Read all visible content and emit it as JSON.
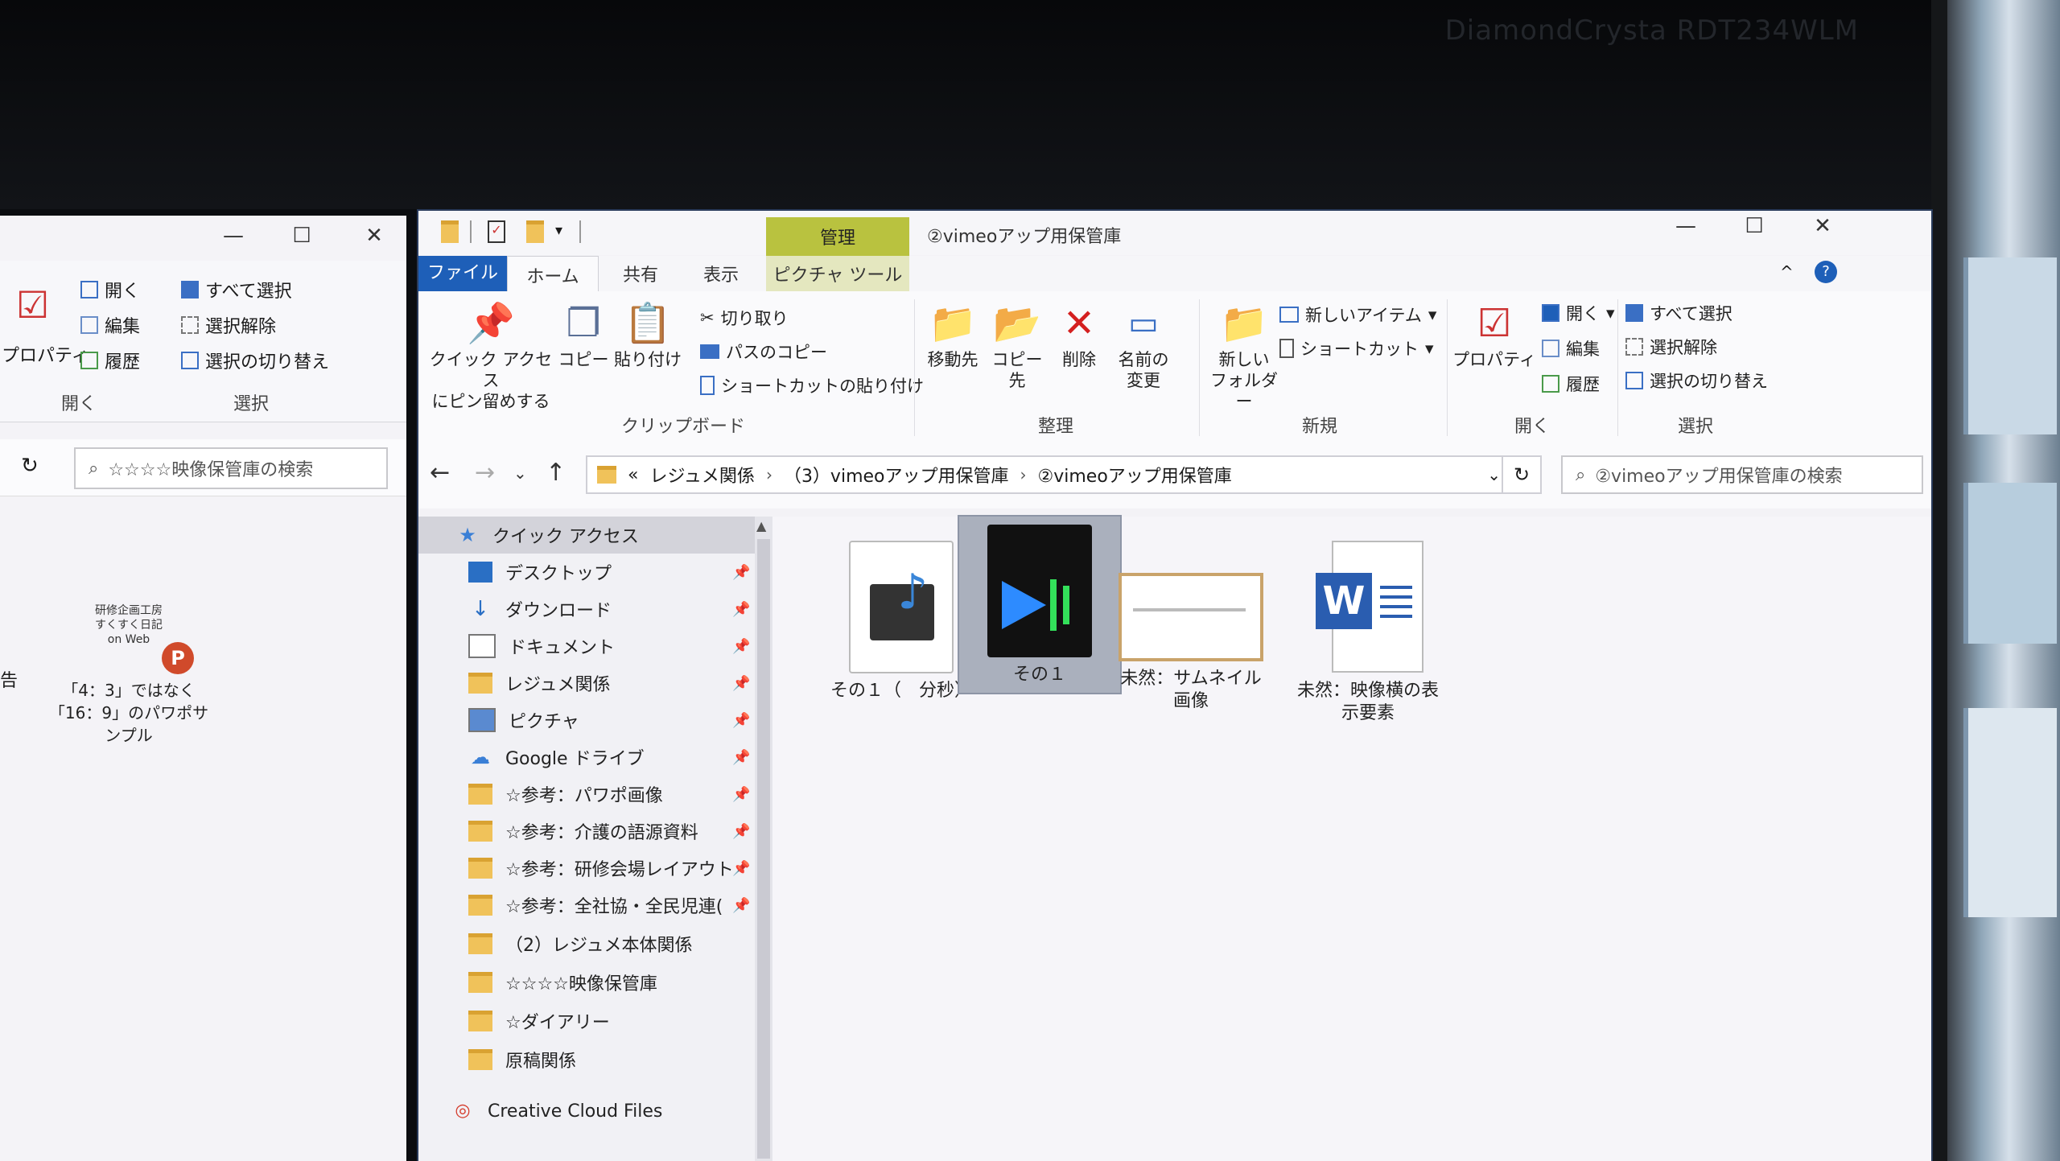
{
  "monitor": {
    "brand": "DiamondCrysta RDT234WLM"
  },
  "left_window": {
    "caption": {
      "minimize": "—",
      "maximize": "☐",
      "close": "✕"
    },
    "ribbon": {
      "properties": "プロパティ",
      "open": "開く",
      "edit": "編集",
      "history": "履歴",
      "select_all": "すべて選択",
      "deselect": "選択解除",
      "invert": "選択の切り替え",
      "group_open": "開く",
      "group_select": "選択"
    },
    "search_placeholder": "☆☆☆☆映像保管庫の検索",
    "desktop_icon": {
      "thumb_lines": [
        "研修企画工房",
        "すくすく日記",
        "on Web"
      ],
      "label": "「4：3」ではなく「16：9」のパワポサンプル",
      "left_cut_label": "告"
    }
  },
  "main_window": {
    "title": "②vimeoアップ用保管庫",
    "context_tab": "管理",
    "tabs": {
      "file": "ファイル",
      "home": "ホーム",
      "share": "共有",
      "view": "表示",
      "picture_tools": "ピクチャ ツール"
    },
    "ribbon": {
      "pin_quick_access": [
        "クイック アクセス",
        "にピン留めする"
      ],
      "copy": "コピー",
      "paste": "貼り付け",
      "cut": "切り取り",
      "copy_path": "パスのコピー",
      "paste_shortcut": "ショートカットの貼り付け",
      "group_clipboard": "クリップボード",
      "move_to": "移動先",
      "copy_to": "コピー先",
      "delete": "削除",
      "rename": [
        "名前の",
        "変更"
      ],
      "group_organize": "整理",
      "new_folder": [
        "新しい",
        "フォルダー"
      ],
      "new_item": "新しいアイテム",
      "shortcut": "ショートカット",
      "group_new": "新規",
      "properties": "プロパティ",
      "open": "開く",
      "edit": "編集",
      "history": "履歴",
      "group_open": "開く",
      "select_all": "すべて選択",
      "deselect": "選択解除",
      "invert": "選択の切り替え",
      "group_select": "選択"
    },
    "address": {
      "overflow": "«",
      "crumbs": [
        "レジュメ関係",
        "（3）vimeoアップ用保管庫",
        "②vimeoアップ用保管庫"
      ],
      "search_placeholder": "②vimeoアップ用保管庫の検索"
    },
    "nav": [
      {
        "label": "クイック アクセス",
        "icon": "star-icon",
        "pinned": false
      },
      {
        "label": "デスクトップ",
        "icon": "desktop-icon",
        "pinned": true
      },
      {
        "label": "ダウンロード",
        "icon": "download-icon",
        "pinned": true
      },
      {
        "label": "ドキュメント",
        "icon": "document-icon",
        "pinned": true
      },
      {
        "label": "レジュメ関係",
        "icon": "folder-icon",
        "pinned": true
      },
      {
        "label": "ピクチャ",
        "icon": "pictures-icon",
        "pinned": true
      },
      {
        "label": "Google ドライブ",
        "icon": "cloud-icon",
        "pinned": true
      },
      {
        "label": "☆参考：パワポ画像",
        "icon": "folder-icon",
        "pinned": true
      },
      {
        "label": "☆参考：介護の語源資料",
        "icon": "folder-icon",
        "pinned": true
      },
      {
        "label": "☆参考：研修会場レイアウト",
        "icon": "folder-icon",
        "pinned": true
      },
      {
        "label": "☆参考：全社協・全民児連(",
        "icon": "folder-icon",
        "pinned": true
      },
      {
        "label": "（2）レジュメ本体関係",
        "icon": "folder-icon",
        "pinned": false
      },
      {
        "label": "☆☆☆☆映像保管庫",
        "icon": "folder-icon",
        "pinned": false
      },
      {
        "label": "☆ダイアリー",
        "icon": "folder-icon",
        "pinned": false
      },
      {
        "label": "原稿関係",
        "icon": "folder-icon",
        "pinned": false
      },
      {
        "label": "Creative Cloud Files",
        "icon": "creative-cloud-icon",
        "pinned": false
      }
    ],
    "files": [
      {
        "name": "その１（　分秒）",
        "type": "video-file-icon",
        "selected": false
      },
      {
        "name": "その１",
        "type": "video-editor-icon",
        "selected": true
      },
      {
        "name": "未然：サムネイル画像",
        "type": "image-thumbnail",
        "selected": false
      },
      {
        "name": "未然：映像横の表示要素",
        "type": "word-icon",
        "selected": false
      }
    ],
    "colors": {
      "file_tab": "#1e5fb8",
      "context_tab": "#b9c23f",
      "selection": "#aab0bd"
    }
  }
}
